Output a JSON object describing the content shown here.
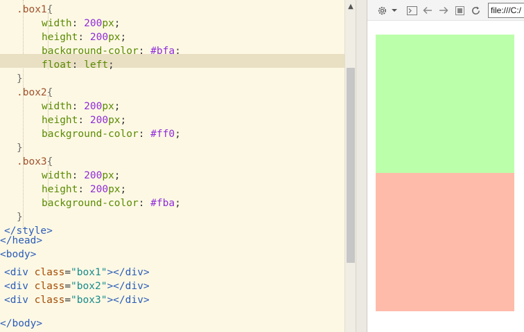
{
  "editor": {
    "lines": [
      {
        "indent": "    ",
        "tokens": [
          {
            "c": "t-sel",
            "t": ".box1"
          },
          {
            "c": "t-brace",
            "t": "{"
          }
        ]
      },
      {
        "indent": "        ",
        "tokens": [
          {
            "c": "t-prop",
            "t": "width"
          },
          {
            "c": "t-plain",
            "t": ": "
          },
          {
            "c": "t-num",
            "t": "200"
          },
          {
            "c": "t-prop",
            "t": "px"
          },
          {
            "c": "t-plain",
            "t": ";"
          }
        ]
      },
      {
        "indent": "        ",
        "tokens": [
          {
            "c": "t-prop",
            "t": "height"
          },
          {
            "c": "t-plain",
            "t": ": "
          },
          {
            "c": "t-num",
            "t": "200"
          },
          {
            "c": "t-prop",
            "t": "px"
          },
          {
            "c": "t-plain",
            "t": ";"
          }
        ]
      },
      {
        "indent": "        ",
        "tokens": [
          {
            "c": "t-prop",
            "t": "background-color"
          },
          {
            "c": "t-plain",
            "t": ": "
          },
          {
            "c": "t-hex",
            "t": "#bfa"
          },
          {
            "c": "t-plain",
            "t": ";"
          }
        ]
      },
      {
        "indent": "        ",
        "highlight": true,
        "tokens": [
          {
            "c": "t-prop",
            "t": "float"
          },
          {
            "c": "t-plain",
            "t": ": "
          },
          {
            "c": "t-prop",
            "t": "left"
          },
          {
            "c": "t-plain",
            "t": ";"
          }
        ]
      },
      {
        "indent": "    ",
        "tokens": [
          {
            "c": "t-brace",
            "t": "}"
          }
        ]
      },
      {
        "indent": "    ",
        "tokens": [
          {
            "c": "t-sel",
            "t": ".box2"
          },
          {
            "c": "t-brace",
            "t": "{"
          }
        ]
      },
      {
        "indent": "        ",
        "tokens": [
          {
            "c": "t-prop",
            "t": "width"
          },
          {
            "c": "t-plain",
            "t": ": "
          },
          {
            "c": "t-num",
            "t": "200"
          },
          {
            "c": "t-prop",
            "t": "px"
          },
          {
            "c": "t-plain",
            "t": ";"
          }
        ]
      },
      {
        "indent": "        ",
        "tokens": [
          {
            "c": "t-prop",
            "t": "height"
          },
          {
            "c": "t-plain",
            "t": ": "
          },
          {
            "c": "t-num",
            "t": "200"
          },
          {
            "c": "t-prop",
            "t": "px"
          },
          {
            "c": "t-plain",
            "t": ";"
          }
        ]
      },
      {
        "indent": "        ",
        "tokens": [
          {
            "c": "t-prop",
            "t": "background-color"
          },
          {
            "c": "t-plain",
            "t": ": "
          },
          {
            "c": "t-hex",
            "t": "#ff0"
          },
          {
            "c": "t-plain",
            "t": ";"
          }
        ]
      },
      {
        "indent": "    ",
        "tokens": [
          {
            "c": "t-brace",
            "t": "}"
          }
        ]
      },
      {
        "indent": "    ",
        "tokens": [
          {
            "c": "t-sel",
            "t": ".box3"
          },
          {
            "c": "t-brace",
            "t": "{"
          }
        ]
      },
      {
        "indent": "        ",
        "tokens": [
          {
            "c": "t-prop",
            "t": "width"
          },
          {
            "c": "t-plain",
            "t": ": "
          },
          {
            "c": "t-num",
            "t": "200"
          },
          {
            "c": "t-prop",
            "t": "px"
          },
          {
            "c": "t-plain",
            "t": ";"
          }
        ]
      },
      {
        "indent": "        ",
        "tokens": [
          {
            "c": "t-prop",
            "t": "height"
          },
          {
            "c": "t-plain",
            "t": ": "
          },
          {
            "c": "t-num",
            "t": "200"
          },
          {
            "c": "t-prop",
            "t": "px"
          },
          {
            "c": "t-plain",
            "t": ";"
          }
        ]
      },
      {
        "indent": "        ",
        "tokens": [
          {
            "c": "t-prop",
            "t": "background-color"
          },
          {
            "c": "t-plain",
            "t": ": "
          },
          {
            "c": "t-hex",
            "t": "#fba"
          },
          {
            "c": "t-plain",
            "t": ";"
          }
        ]
      },
      {
        "indent": "    ",
        "tokens": [
          {
            "c": "t-brace",
            "t": "}"
          }
        ]
      },
      {
        "indent": "  ",
        "tokens": [
          {
            "c": "t-tag",
            "t": "</style>"
          }
        ]
      },
      {
        "indent": "",
        "tokens": [
          {
            "c": "t-tag",
            "t": "</head>"
          }
        ]
      },
      {
        "indent": "",
        "tokens": [
          {
            "c": "t-tag",
            "t": "<body>"
          }
        ]
      },
      {
        "indent": "  ",
        "tokens": [
          {
            "c": "t-tag",
            "t": "<div "
          },
          {
            "c": "t-attr",
            "t": "class"
          },
          {
            "c": "t-plain",
            "t": "="
          },
          {
            "c": "t-str",
            "t": "\"box1\""
          },
          {
            "c": "t-tag",
            "t": "></div>"
          }
        ]
      },
      {
        "indent": "  ",
        "tokens": [
          {
            "c": "t-tag",
            "t": "<div "
          },
          {
            "c": "t-attr",
            "t": "class"
          },
          {
            "c": "t-plain",
            "t": "="
          },
          {
            "c": "t-str",
            "t": "\"box2\""
          },
          {
            "c": "t-tag",
            "t": "></div>"
          }
        ]
      },
      {
        "indent": "  ",
        "tokens": [
          {
            "c": "t-tag",
            "t": "<div "
          },
          {
            "c": "t-attr",
            "t": "class"
          },
          {
            "c": "t-plain",
            "t": "="
          },
          {
            "c": "t-str",
            "t": "\"box3\""
          },
          {
            "c": "t-tag",
            "t": "></div>"
          }
        ]
      },
      {
        "indent": "",
        "tokens": []
      },
      {
        "indent": "",
        "tokens": [
          {
            "c": "t-tag",
            "t": "</body>"
          }
        ]
      }
    ]
  },
  "browser": {
    "address": "file:///C:/",
    "icons": [
      "gear-icon",
      "dropdown-arrow-icon",
      "console-icon",
      "back-arrow-icon",
      "forward-arrow-icon",
      "stop-icon",
      "refresh-icon"
    ],
    "boxes": [
      {
        "name": "box1",
        "color": "#bbffaa"
      },
      {
        "name": "box3",
        "color": "#ffbbaa"
      }
    ]
  }
}
